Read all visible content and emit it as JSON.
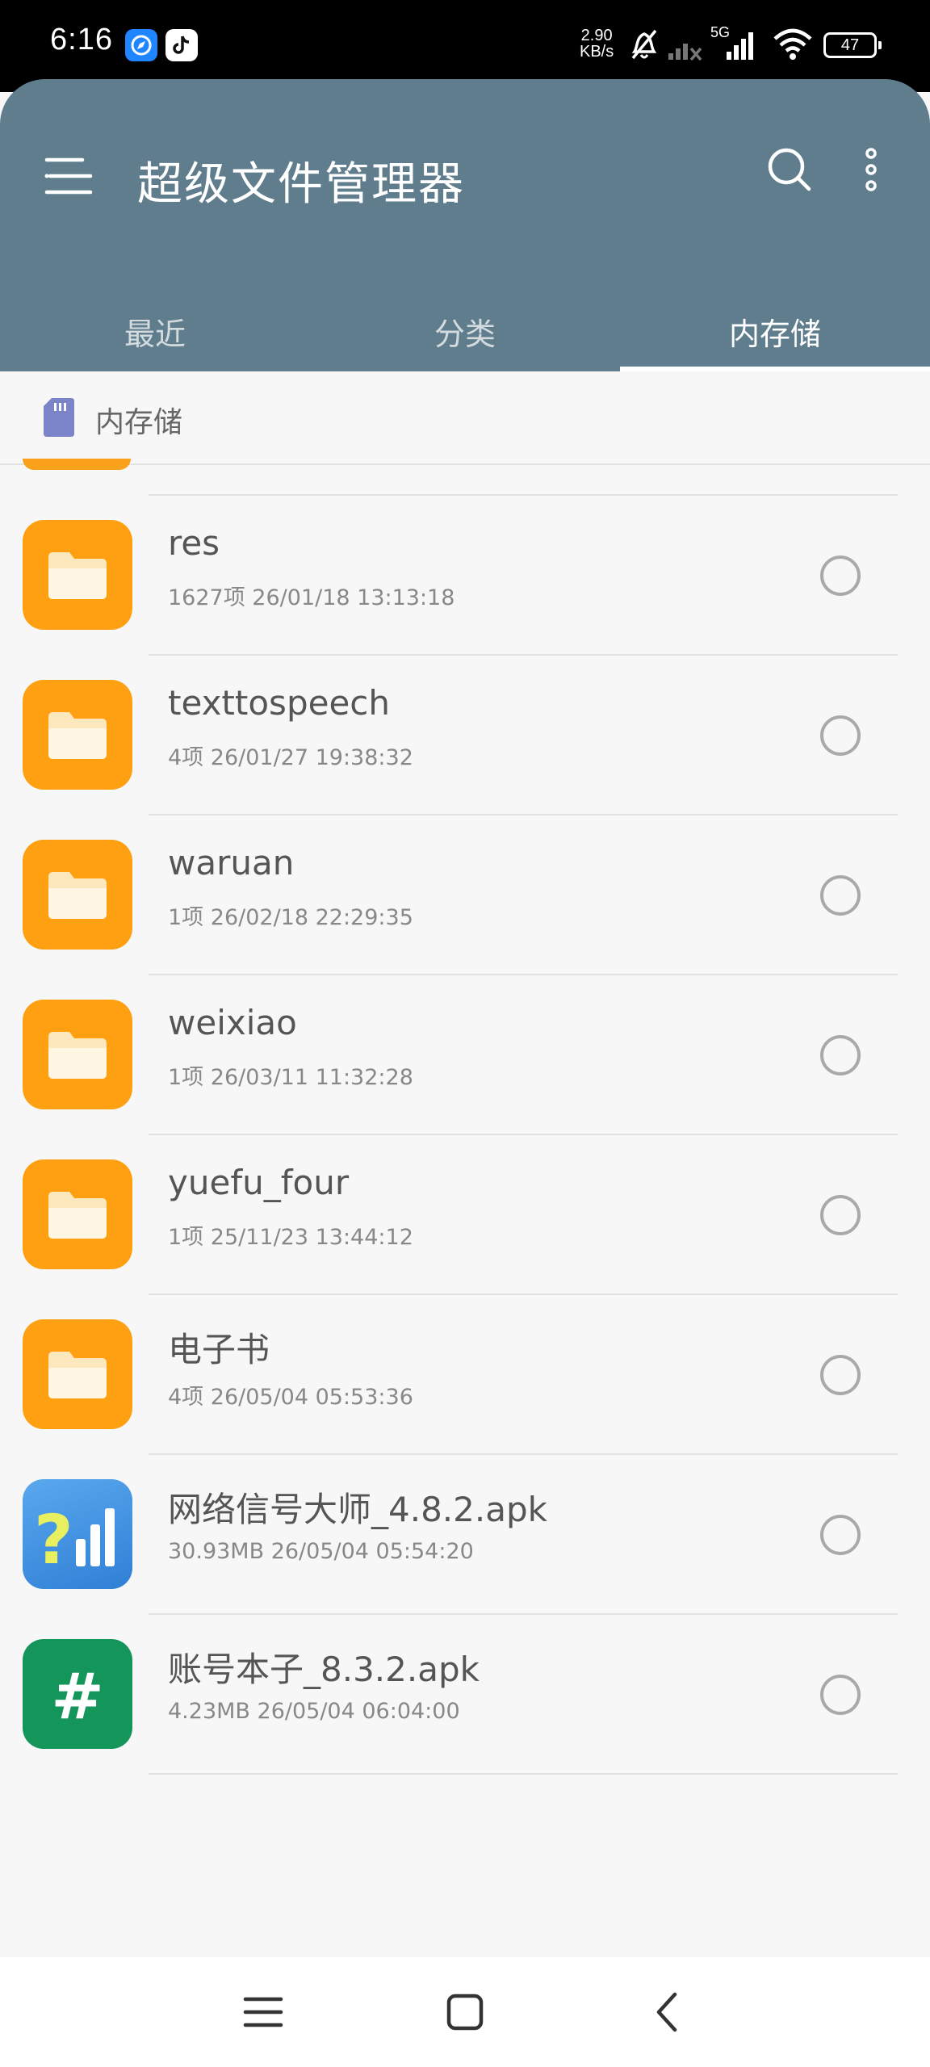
{
  "status_bar": {
    "time": "6:16",
    "net_speed_value": "2.90",
    "net_speed_unit": "KB/s",
    "network_label": "5G",
    "battery": "47"
  },
  "header": {
    "title": "超级文件管理器",
    "tabs": [
      {
        "label": "最近",
        "active": false
      },
      {
        "label": "分类",
        "active": false
      },
      {
        "label": "内存储",
        "active": true
      }
    ]
  },
  "breadcrumb": {
    "label": "内存储"
  },
  "files": [
    {
      "name": "res",
      "meta": "1627项  26/01/18 13:13:18",
      "type": "folder"
    },
    {
      "name": "texttospeech",
      "meta": "4项  26/01/27 19:38:32",
      "type": "folder"
    },
    {
      "name": "waruan",
      "meta": "1项  26/02/18 22:29:35",
      "type": "folder"
    },
    {
      "name": "weixiao",
      "meta": "1项  26/03/11 11:32:28",
      "type": "folder"
    },
    {
      "name": "yuefu_four",
      "meta": "1项  25/11/23 13:44:12",
      "type": "folder"
    },
    {
      "name": "电子书",
      "meta": "4项  26/05/04 05:53:36",
      "type": "folder"
    },
    {
      "name": "网络信号大师_4.8.2.apk",
      "meta": "30.93MB  26/05/04 05:54:20",
      "type": "apk-signal"
    },
    {
      "name": "账号本子_8.3.2.apk",
      "meta": "4.23MB  26/05/04 06:04:00",
      "type": "apk-hash"
    }
  ],
  "colors": {
    "header_bg": "#607d8d",
    "folder": "#ffa012",
    "apk_signal": "#3f8fe0",
    "apk_hash": "#14955a"
  },
  "icons": {
    "menu": "menu-icon",
    "search": "search-icon",
    "more": "more-vert-icon",
    "storage": "sd-card-icon",
    "folder": "folder-icon",
    "nav_menu": "recents-icon",
    "nav_home": "home-icon",
    "nav_back": "back-icon"
  }
}
